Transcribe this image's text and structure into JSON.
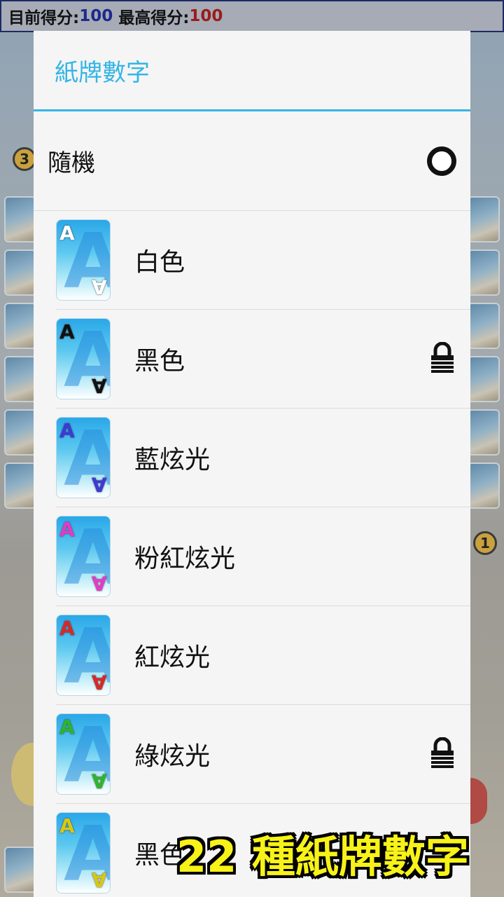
{
  "score": {
    "current_label": "目前得分:",
    "current_value": "100",
    "best_label": "最高得分:",
    "best_value": "100"
  },
  "dialog": {
    "title": "紙牌數字",
    "random_label": "隨機",
    "items": [
      {
        "label": "白色",
        "corner": "A",
        "corner_color": "#ffffff",
        "locked": false
      },
      {
        "label": "黑色",
        "corner": "A",
        "corner_color": "#111111",
        "locked": true
      },
      {
        "label": "藍炫光",
        "corner": "A",
        "corner_color": "#3b3bd6",
        "locked": false
      },
      {
        "label": "粉紅炫光",
        "corner": "A",
        "corner_color": "#e23cc8",
        "locked": false
      },
      {
        "label": "紅炫光",
        "corner": "A",
        "corner_color": "#d42a2a",
        "locked": false
      },
      {
        "label": "綠炫光",
        "corner": "A",
        "corner_color": "#2cb52c",
        "locked": true
      },
      {
        "label": "黑色",
        "corner": "A",
        "corner_color": "#d8c814",
        "locked": false
      }
    ]
  },
  "background": {
    "badge_top": "3",
    "badge_right": "1"
  },
  "promo_text": "22 種紙牌數字",
  "colors": {
    "accent": "#33b5e5",
    "score_current": "#1c2a8c",
    "score_best": "#9a1c1c",
    "promo": "#f7f218"
  },
  "icons": [
    "radio-unselected-icon",
    "lock-icon"
  ]
}
